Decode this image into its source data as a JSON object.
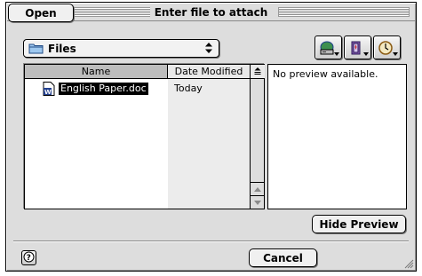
{
  "window": {
    "title": "Enter file to attach"
  },
  "location": {
    "selected": "Files",
    "icon": "folder-icon",
    "arrow_icon": "updown-arrow-icon"
  },
  "toolbar": {
    "buttons": [
      {
        "name": "shortcuts-button",
        "icon": "drive-icon"
      },
      {
        "name": "favorites-button",
        "icon": "favorites-folder-icon"
      },
      {
        "name": "recent-button",
        "icon": "clock-icon"
      }
    ]
  },
  "file_list": {
    "columns": [
      "Name",
      "Date Modified"
    ],
    "sort_icon": "sort-order-icon",
    "rows": [
      {
        "name": "English Paper.doc",
        "date": "Today",
        "icon": "word-document-icon",
        "selected": true
      }
    ]
  },
  "preview": {
    "message": "No preview available."
  },
  "buttons": {
    "hide_preview": "Hide Preview",
    "cancel": "Cancel",
    "open": "Open",
    "help_icon": "help-icon"
  },
  "colors": {
    "dialog_bg": "#dddddd",
    "selection": "#000000",
    "date_column_bg": "#ececec",
    "name_header_bg": "#bdbdbd"
  }
}
